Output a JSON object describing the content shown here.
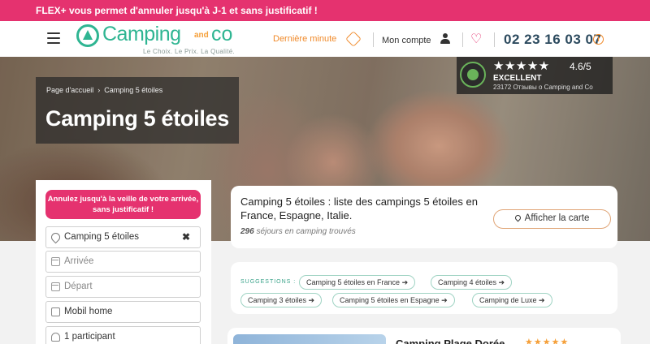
{
  "promo": {
    "text": "FLEX+ vous permet d'annuler jusqu'à J-1 et sans justificatif !"
  },
  "header": {
    "logo_text": "Camping",
    "logo_and": "and",
    "logo_co": "co",
    "logo_tagline": "Le Choix. Le Prix. La Qualité.",
    "last_minute": "Dernière minute",
    "account": "Mon compte",
    "phone": "02 23 16 03 07",
    "info": "i",
    "heart": "♡"
  },
  "hero": {
    "breadcrumb": [
      "Page d'accueil",
      "Camping 5 étoiles"
    ],
    "breadcrumb_sep": "›",
    "title": "Camping 5 étoiles"
  },
  "rating": {
    "stars": "★★★★★",
    "score": "4.6/5",
    "label": "EXCELLENT",
    "reviews": "23172 Отзывы о Camping and Co"
  },
  "sidebar": {
    "flex_button": "Annulez jusqu'à la veille de votre arrivée, sans justificatif !",
    "destination": "Camping 5 étoiles",
    "clear": "✖",
    "arrival": "Arrivée",
    "departure": "Départ",
    "accommodation": "Mobil home",
    "participants": "1 participant"
  },
  "results": {
    "title": "Camping 5 étoiles : liste des campings 5 étoiles en France, Espagne, Italie.",
    "count_number": "296",
    "count_text": " séjours en camping trouvés",
    "map_button": "Afficher la carte"
  },
  "suggestions": {
    "label": "SUGGESTIONS :",
    "items": [
      "Camping 5 étoiles en France ➔",
      "Camping 4 étoiles ➔",
      "Camping 3 étoiles ➔",
      "Camping 5 étoiles en Espagne ➔",
      "Camping de Luxe ➔"
    ]
  },
  "listing": {
    "title": "Camping Plage Dorée",
    "stars": "★★★★★"
  },
  "colors": {
    "brand_pink": "#e5326f",
    "brand_green": "#2fb592",
    "accent_orange": "#f08a2a",
    "phone_navy": "#2c4a5e"
  },
  "icons": [
    "menu-icon",
    "flame-icon",
    "user-icon",
    "heart-icon",
    "info-icon",
    "pin-icon",
    "calendar-icon",
    "home-icon",
    "people-icon",
    "close-icon",
    "map-pin-icon"
  ]
}
